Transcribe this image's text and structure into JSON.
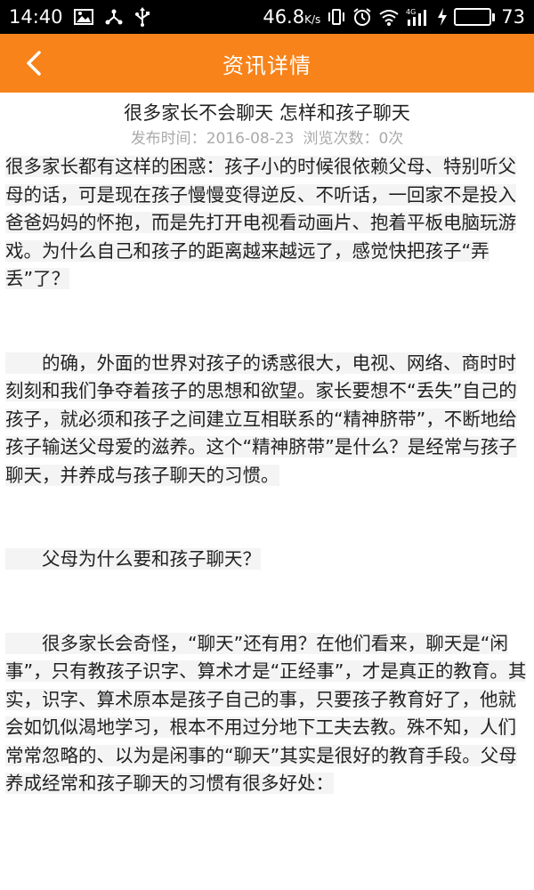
{
  "status_bar": {
    "time": "14:40",
    "speed": "46.8",
    "speed_unit": "K/s",
    "network_label": "4G",
    "battery_level": "73",
    "battery_fraction": 0.73,
    "icons": [
      "image-icon",
      "share-icon",
      "usb-icon",
      "vibrate-icon",
      "alarm-icon",
      "wifi-icon",
      "signal-icon",
      "charging-icon",
      "battery-icon"
    ]
  },
  "app_bar": {
    "title": "资讯详情",
    "back_icon": "chevron-left-icon",
    "color": "#f7831a"
  },
  "article": {
    "title": "很多家长不会聊天 怎样和孩子聊天",
    "publish_label": "发布时间：",
    "publish_date": "2016-08-23",
    "views_label": "浏览次数：",
    "views_count": "0次",
    "paragraphs": [
      "很多家长都有这样的困惑：孩子小的时候很依赖父母、特别听父母的话，可是现在孩子慢慢变得逆反、不听话，一回家不是投入爸爸妈妈的怀抱，而是先打开电视看动画片、抱着平板电脑玩游戏。为什么自己和孩子的距离越来越远了，感觉快把孩子“弄丢”了？",
      "　　的确，外面的世界对孩子的诱惑很大，电视、网络、商时时刻刻和我们争夺着孩子的思想和欲望。家长要想不“丢失”自己的孩子，就必须和孩子之间建立互相联系的“精神脐带”，不断地给孩子输送父母爱的滋养。这个“精神脐带”是什么？是经常与孩子聊天，并养成与孩子聊天的习惯。",
      "　　父母为什么要和孩子聊天？",
      "　　很多家长会奇怪，“聊天”还有用？在他们看来，聊天是“闲事”，只有教孩子识字、算术才是“正经事”，才是真正的教育。其实，识字、算术原本是孩子自己的事，只要孩子教育好了，他就会如饥似渴地学习，根本不用过分地下工夫去教。殊不知，人们常常忽略的、以为是闲事的“聊天”其实是很好的教育手段。父母养成经常和孩子聊天的习惯有很多好处："
    ]
  }
}
